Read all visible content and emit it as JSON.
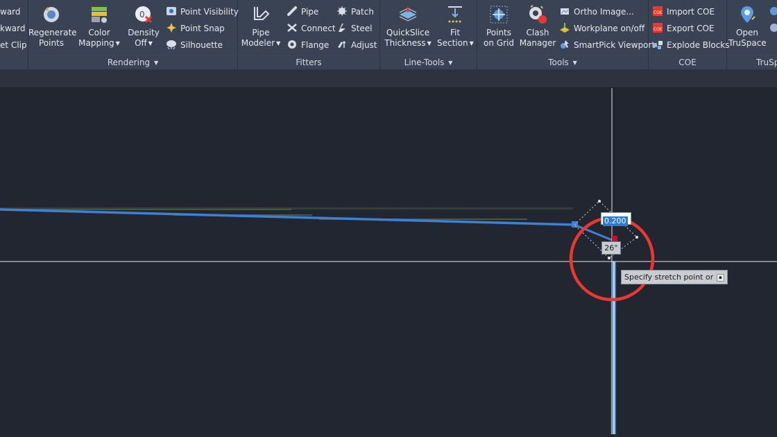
{
  "ribbon": {
    "left_partial": {
      "items": [
        "ward",
        "kward",
        "et Clip"
      ]
    },
    "rendering": {
      "title": "Rendering",
      "regenerate": {
        "line1": "Regenerate",
        "line2": "Points"
      },
      "color_mapping": {
        "line1": "Color",
        "line2": "Mapping"
      },
      "density": {
        "line1": "Density",
        "line2": "Off"
      },
      "point_visibility": "Point Visibility",
      "point_snap": "Point Snap",
      "silhouette": "Silhouette"
    },
    "fitters": {
      "title": "Fitters",
      "pipe_modeler": {
        "line1": "Pipe",
        "line2": "Modeler"
      },
      "pipe": "Pipe",
      "connect": "Connect",
      "flange": "Flange",
      "patch": "Patch",
      "steel": "Steel",
      "adjust": "Adjust"
    },
    "line_tools": {
      "title": "Line-Tools",
      "quickslice": {
        "line1": "QuickSlice",
        "line2": "Thickness"
      },
      "fit_section": {
        "line1": "Fit",
        "line2": "Section"
      }
    },
    "tools": {
      "title": "Tools",
      "points_on_grid": {
        "line1": "Points",
        "line2": "on Grid"
      },
      "clash_manager": {
        "line1": "Clash",
        "line2": "Manager"
      },
      "ortho_image": "Ortho Image...",
      "workplane": "Workplane on/off",
      "smartpick": "SmartPick Viewport"
    },
    "coe": {
      "title": "COE",
      "import": "Import COE",
      "export": "Export COE",
      "explode": "Explode Blocks"
    },
    "truspace": {
      "title": "TruSp",
      "open": {
        "line1": "Open",
        "line2": "TruSpace"
      }
    }
  },
  "viewport": {
    "angle_label": "26°",
    "length_value": "0.200",
    "tooltip": "Specify stretch point or"
  },
  "colors": {
    "ribbon_bg": "#3a4354",
    "canvas_bg": "#212630",
    "pipe_blue": "#3f7fd6",
    "highlight_red": "#e8392e",
    "crosshair": "#e6e6e6"
  }
}
